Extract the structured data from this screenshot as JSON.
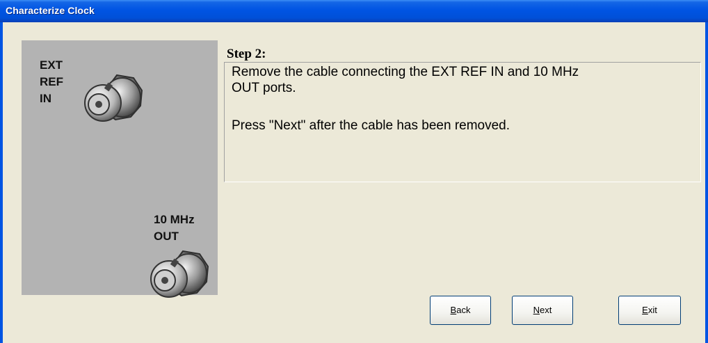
{
  "window": {
    "title": "Characterize Clock"
  },
  "left_panel": {
    "ext_ref_label": [
      "EXT",
      "REF",
      "IN"
    ],
    "ten_mhz_label": [
      "10 MHz",
      "OUT"
    ]
  },
  "step": {
    "title": "Step 2:",
    "lines": [
      "Remove the cable connecting the EXT REF IN and 10 MHz",
      "OUT ports.",
      "Press \"Next\" after the cable has been removed."
    ]
  },
  "buttons": {
    "back": {
      "label": "Back",
      "mnemonic": "B",
      "rest": "ack"
    },
    "next": {
      "label": "Next",
      "mnemonic": "N",
      "rest": "ext"
    },
    "exit": {
      "label": "Exit",
      "mnemonic": "E",
      "rest": "xit"
    }
  },
  "colors": {
    "titlebar": "#0054e3",
    "dialog_bg": "#ece9d8",
    "panel_bg": "#b3b3b3"
  }
}
